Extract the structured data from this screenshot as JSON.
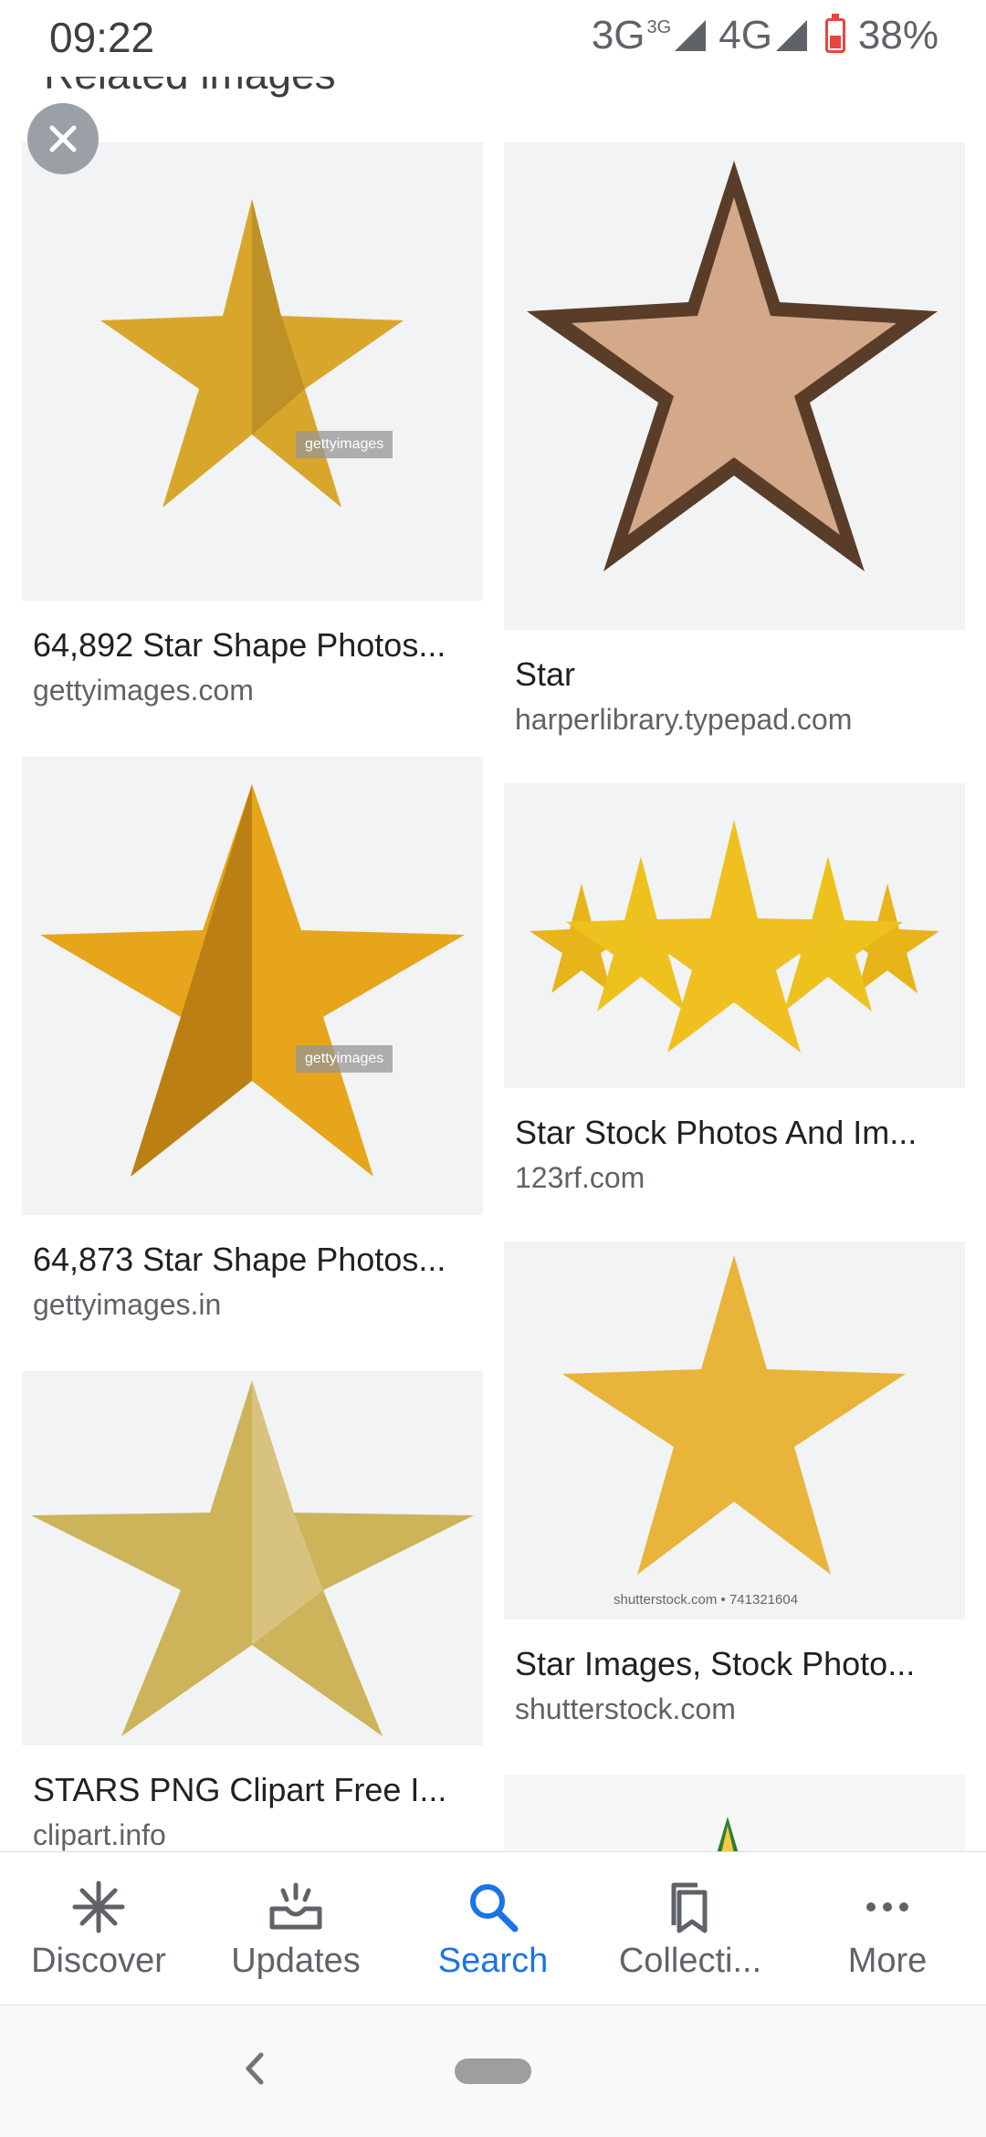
{
  "status_bar": {
    "time": "09:22",
    "network1": "3G",
    "network1_sup": "3G",
    "network2": "4G",
    "battery": "38%"
  },
  "section_title": "Related images",
  "results": [
    {
      "title": "64,892 Star Shape Photos...",
      "source": "gettyimages.com",
      "color": "#d9a62c",
      "watermark": "gettyimages"
    },
    {
      "title": "Star",
      "source": "harperlibrary.typepad.com",
      "color": "#d4a98a"
    },
    {
      "title": "64,873 Star Shape Photos...",
      "source": "gettyimages.in",
      "color": "#e6a51a",
      "watermark": "gettyimages"
    },
    {
      "title": "Star Stock Photos And Im...",
      "source": "123rf.com",
      "color": "#f0c020"
    },
    {
      "title": "STARS PNG Clipart Free I...",
      "source": "clipart.info",
      "color": "#cdb35a"
    },
    {
      "title": "Star Images, Stock Photo...",
      "source": "shutterstock.com",
      "color": "#e9b43a",
      "watermark": "shutterstock.com • 741321604"
    }
  ],
  "bottom_nav": [
    {
      "label": "Discover",
      "icon": "discover-asterisk-icon",
      "active": false
    },
    {
      "label": "Updates",
      "icon": "updates-tray-icon",
      "active": false
    },
    {
      "label": "Search",
      "icon": "search-icon",
      "active": true
    },
    {
      "label": "Collecti...",
      "icon": "collections-bookmark-icon",
      "active": false
    },
    {
      "label": "More",
      "icon": "more-dots-icon",
      "active": false
    }
  ],
  "colors": {
    "accent": "#1a73e8",
    "text": "#202124",
    "secondary": "#5f6368"
  }
}
